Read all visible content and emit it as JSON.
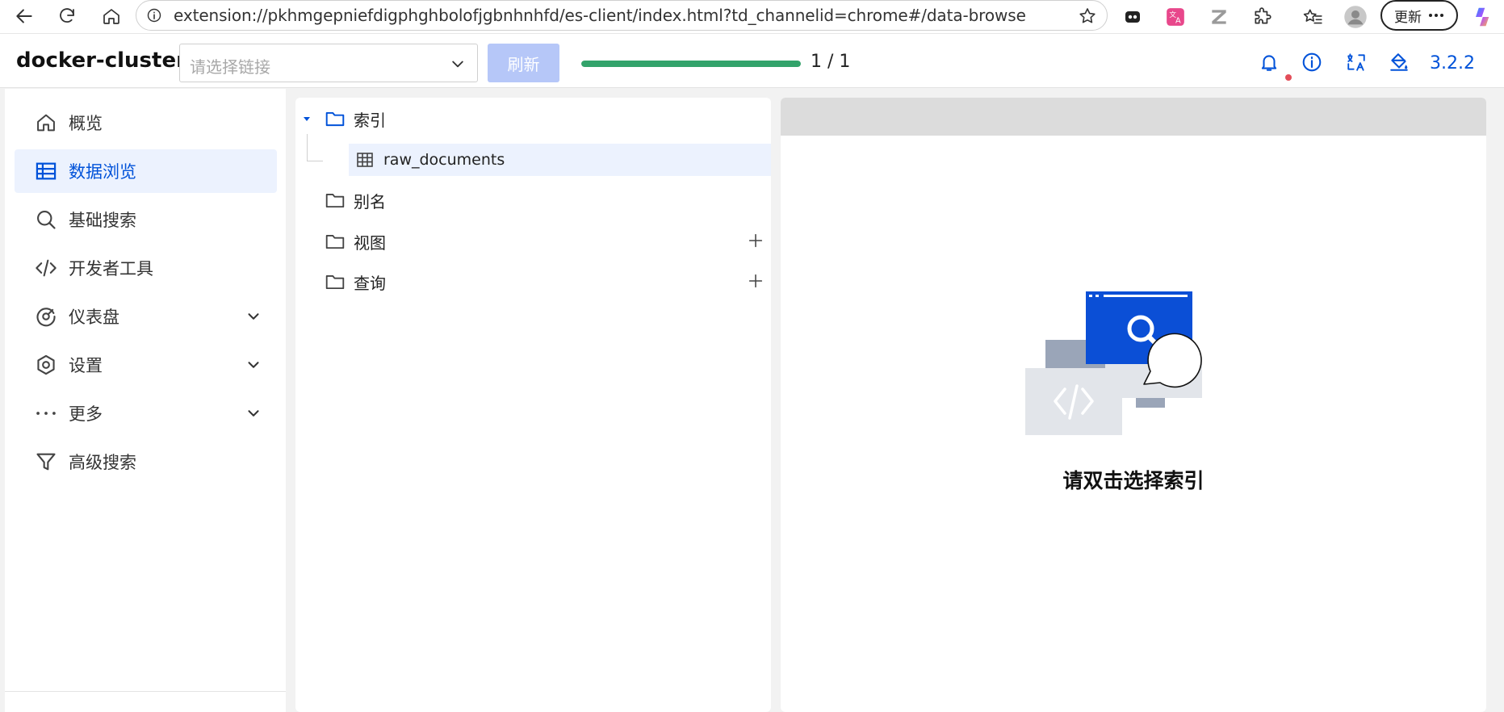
{
  "browser": {
    "url": "extension://pkhmgepniefdigphghbolofjgbnhnhfd/es-client/index.html?td_channelid=chrome#/data-browse",
    "update_label": "更新"
  },
  "header": {
    "cluster_name": "docker-cluster",
    "connection_placeholder": "请选择链接",
    "refresh_label": "刷新",
    "progress_text": "1 / 1",
    "progress_fraction": 1.0,
    "version": "3.2.2",
    "accent_color": "#0052d9"
  },
  "sidebar": {
    "items": [
      {
        "label": "概览",
        "icon": "home-icon"
      },
      {
        "label": "数据浏览",
        "icon": "table-icon",
        "active": true
      },
      {
        "label": "基础搜索",
        "icon": "search-icon"
      },
      {
        "label": "开发者工具",
        "icon": "code-icon"
      },
      {
        "label": "仪表盘",
        "icon": "dashboard-icon",
        "expandable": true
      },
      {
        "label": "设置",
        "icon": "settings-icon",
        "expandable": true
      },
      {
        "label": "更多",
        "icon": "more-icon",
        "expandable": true
      },
      {
        "label": "高级搜索",
        "icon": "filter-icon"
      }
    ]
  },
  "tree": {
    "nodes": [
      {
        "label": "索引",
        "expanded": true,
        "children": [
          {
            "label": "raw_documents"
          }
        ]
      },
      {
        "label": "别名"
      },
      {
        "label": "视图",
        "addable": true
      },
      {
        "label": "查询",
        "addable": true
      }
    ]
  },
  "content": {
    "empty_text": "请双击选择索引"
  }
}
